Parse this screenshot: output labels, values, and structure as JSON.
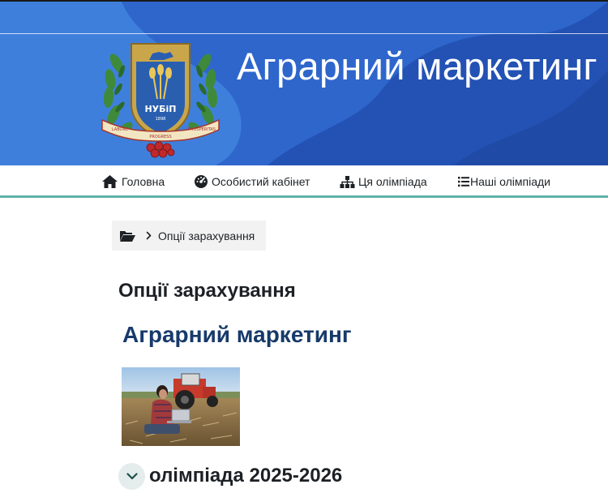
{
  "site": {
    "title": "Аграрний маркетинг"
  },
  "emblem": {
    "label_main": "НУБіП",
    "label_year": "1898",
    "ribbon_left": "LABORE",
    "ribbon_center": "PROGRESS",
    "ribbon_right": "PROSPERITAS"
  },
  "nav": {
    "items": [
      {
        "label": "Головна",
        "icon": "home-icon"
      },
      {
        "label": "Особистий кабінет",
        "icon": "dashboard-icon"
      },
      {
        "label": "Ця олімпіада",
        "icon": "sitemap-icon"
      },
      {
        "label": "Наші олімпіади",
        "icon": "list-icon"
      }
    ]
  },
  "breadcrumb": {
    "icon": "folder-open-icon",
    "current": "Опції зарахування"
  },
  "page": {
    "heading": "Опції зарахування",
    "course_title": "Аграрний маркетинг"
  },
  "section": {
    "title": "олімпіада 2025-2026",
    "toggle_icon": "chevron-down-icon"
  },
  "colors": {
    "banner_blue": "#3f7fdc",
    "banner_dark": "#2455b8",
    "nav_accent": "#5fb3a9",
    "course_title": "#173a6a",
    "breadcrumb_bg": "#f2f2f2",
    "toggle_bg": "#e4ecec"
  }
}
